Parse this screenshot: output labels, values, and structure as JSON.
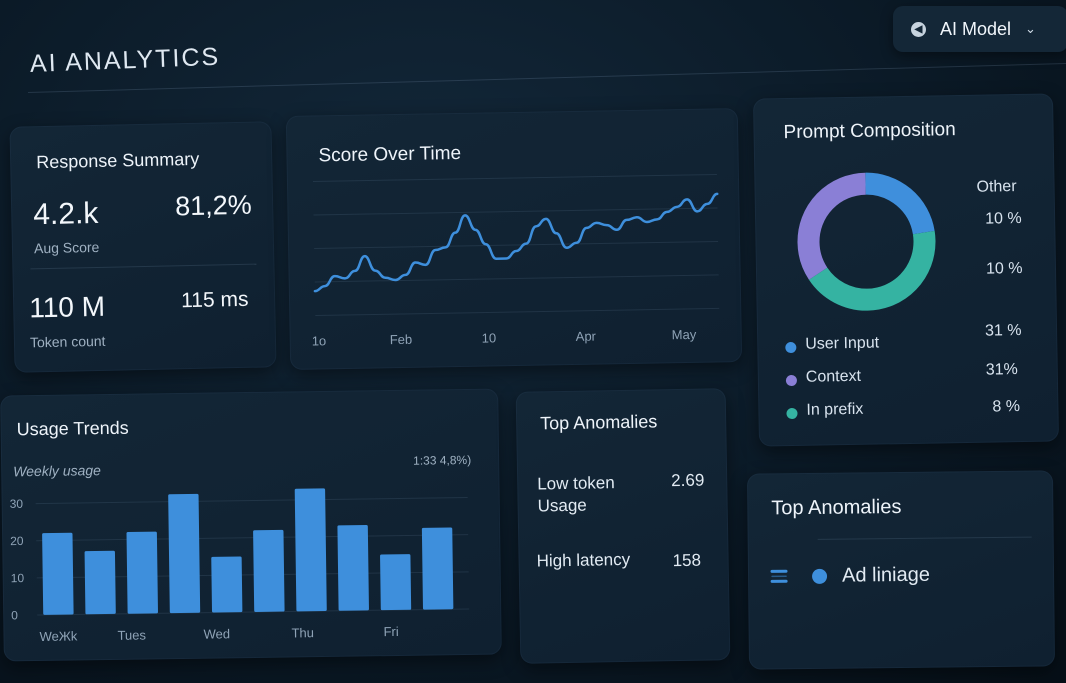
{
  "app": {
    "title": "AI ANALYTICS"
  },
  "model_selector": {
    "label": "AI Model"
  },
  "response_summary": {
    "title": "Response Summary",
    "score": "4.2.k",
    "score_label": "Aug Score",
    "percent": "81,2%",
    "tokens": "110 M",
    "tokens_label": "Token count",
    "latency": "115 ms"
  },
  "score_over_time": {
    "title": "Score Over Time",
    "x_ticks": [
      "1o",
      "Feb",
      "10",
      "Apr",
      "May"
    ]
  },
  "prompt_composition": {
    "title": "Prompt Composition",
    "other_label": "Other",
    "pct_1": "10 %",
    "pct_2": "10 %",
    "legend": [
      {
        "label": "User Input",
        "value": "31 %",
        "color": "#3f8fdc"
      },
      {
        "label": "Context",
        "value": "31%",
        "color": "#8a7fd6"
      },
      {
        "label": "In prefix",
        "value": "8 %",
        "color": "#35b3a2"
      }
    ]
  },
  "usage_trends": {
    "title": "Usage Trends",
    "subtitle": "Weekly usage",
    "stat": "1:33 4,8%)",
    "y_ticks": [
      "30",
      "20",
      "10",
      "0"
    ],
    "x_ticks": [
      "WeЖk",
      "Tues",
      "Wed",
      "Thu",
      "Fri"
    ]
  },
  "top_anomalies_1": {
    "title": "Top Anomalies",
    "items": [
      {
        "label_line1": "Low token",
        "label_line2": "Usage",
        "value": "2.69"
      },
      {
        "label": "High latency",
        "value": "158"
      }
    ]
  },
  "top_anomalies_2": {
    "title": "Top Anomalies",
    "item": "Ad liniage"
  },
  "chart_data": [
    {
      "type": "line",
      "title": "Score Over Time",
      "x_ticks": [
        "1o",
        "Feb",
        "10",
        "Apr",
        "May"
      ],
      "x": [
        0,
        1,
        2,
        3,
        4,
        5,
        6,
        7,
        8,
        9,
        10,
        11,
        12,
        13,
        14,
        15,
        16,
        17,
        18,
        19,
        20,
        21,
        22,
        23,
        24,
        25,
        26,
        27,
        28,
        29,
        30,
        31,
        32,
        33,
        34,
        35,
        36,
        37,
        38,
        39,
        40
      ],
      "values": [
        10,
        12,
        16,
        15,
        18,
        24,
        18,
        15,
        14,
        16,
        21,
        20,
        26,
        27,
        33,
        40,
        34,
        28,
        22,
        22,
        25,
        28,
        35,
        38,
        32,
        26,
        28,
        34,
        36,
        35,
        33,
        37,
        38,
        36,
        37,
        40,
        42,
        45,
        40,
        43,
        47
      ],
      "ylim": [
        0,
        55
      ]
    },
    {
      "type": "pie",
      "title": "Prompt Composition",
      "slices": [
        {
          "label": "User Input",
          "value": 20,
          "color": "#3f8fdc"
        },
        {
          "label": "In prefix",
          "value": 38,
          "color": "#35b3a2"
        },
        {
          "label": "Context",
          "value": 30,
          "color": "#8a7fd6"
        }
      ]
    },
    {
      "type": "bar",
      "title": "Usage Trends",
      "x_ticks": [
        "WeЖk",
        "Tues",
        "Wed",
        "Thu",
        "Fri"
      ],
      "values": [
        22,
        17,
        22,
        32,
        15,
        22,
        33,
        23,
        15,
        22
      ],
      "ylim": [
        0,
        35
      ],
      "y_ticks": [
        0,
        10,
        20,
        30
      ],
      "color": "#3e8fdc"
    }
  ]
}
